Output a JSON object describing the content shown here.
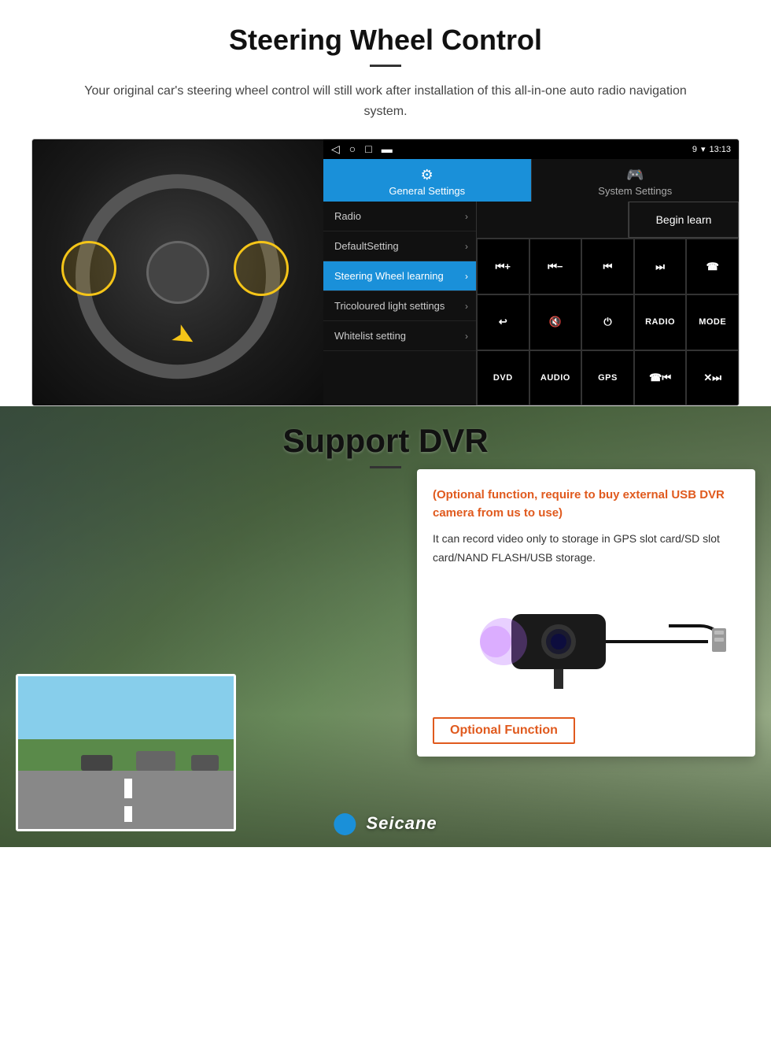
{
  "steering": {
    "title": "Steering Wheel Control",
    "subtitle": "Your original car's steering wheel control will still work after installation of this all-in-one auto radio navigation system.",
    "statusBar": {
      "navIcons": [
        "◁",
        "○",
        "□",
        "▬"
      ],
      "time": "13:13",
      "statusIcons": "9 ▾"
    },
    "tabs": {
      "active": {
        "icon": "⚙",
        "label": "General Settings"
      },
      "inactive": {
        "icon": "🎮",
        "label": "System Settings"
      }
    },
    "menuItems": [
      {
        "label": "Radio",
        "active": false
      },
      {
        "label": "DefaultSetting",
        "active": false
      },
      {
        "label": "Steering Wheel learning",
        "active": true
      },
      {
        "label": "Tricoloured light settings",
        "active": false
      },
      {
        "label": "Whitelist setting",
        "active": false
      }
    ],
    "beginLearnBtn": "Begin learn",
    "controlButtons": [
      "⏮+",
      "⏮−",
      "⏮",
      "⏭",
      "📞",
      "↩",
      "🔇",
      "⏻",
      "RADIO",
      "MODE",
      "DVD",
      "AUDIO",
      "GPS",
      "📞⏮",
      "✖⏭"
    ]
  },
  "dvr": {
    "title": "Support DVR",
    "optionalText": "(Optional function, require to buy external USB DVR camera from us to use)",
    "descText": "It can record video only to storage in GPS slot card/SD slot card/NAND FLASH/USB storage.",
    "optionalBadgeLabel": "Optional Function",
    "watermark": "Seicane"
  }
}
